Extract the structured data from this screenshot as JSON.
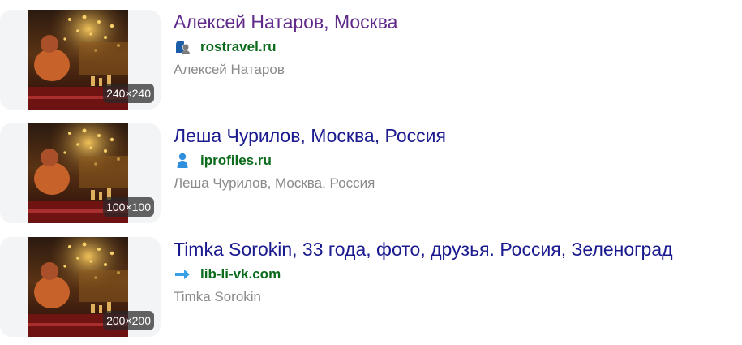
{
  "results": [
    {
      "title": "Алексей Натаров, Москва",
      "domain": "rostravel.ru",
      "snippet": "Алексей Натаров",
      "image_size": "240×240",
      "favicon": "rostravel-logo-icon",
      "title_color": "#5f2a8a"
    },
    {
      "title": "Леша Чурилов, Москва, Россия",
      "domain": "iprofiles.ru",
      "snippet": "Леша Чурилов, Москва, Россия",
      "image_size": "100×100",
      "favicon": "person-icon",
      "title_color": "#1b1b8f"
    },
    {
      "title": "Timka Sorokin, 33 года, фото, друзья. Россия, Зеленоград",
      "domain": "lib-li-vk.com",
      "snippet": "Timka Sorokin",
      "image_size": "200×200",
      "favicon": "arrow-right-icon",
      "title_color": "#1b1b8f"
    }
  ],
  "colors": {
    "domain": "#0b6b1b",
    "snippet": "#8a8a8a",
    "card_background": "#f3f4f6"
  }
}
